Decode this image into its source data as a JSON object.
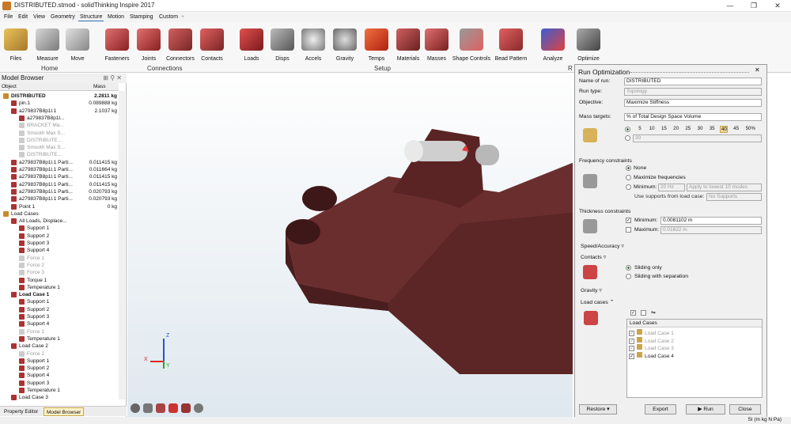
{
  "window": {
    "title": "DISTRIBUTED.stmod - solidThinking Inspire 2017",
    "minimize": "—",
    "restore": "❐",
    "close": "✕"
  },
  "menu": [
    "File",
    "Edit",
    "View",
    "Geometry",
    "Structure",
    "Motion",
    "Stamping",
    "Custom",
    "+"
  ],
  "ribbon": {
    "tools": [
      "Files",
      "Measure",
      "Move",
      "Fasteners",
      "Joints",
      "Connectors",
      "Contacts",
      "Loads",
      "Disps",
      "Accels",
      "Gravity",
      "Temps",
      "Materials",
      "Masses",
      "Shape Controls",
      "Bead Pattern",
      "Analyze",
      "Optimize"
    ],
    "groups": [
      "Home",
      "Connections",
      "Setup",
      "R"
    ]
  },
  "model_browser": {
    "title": "Model Browser",
    "controls": "⊞ ⚲ ✕",
    "col_object": "Object",
    "col_mass": "Mass",
    "rows": [
      {
        "name": "DISTRIBUTED",
        "mass": "2.2811 kg",
        "bold": true,
        "ind": 0
      },
      {
        "name": "pin.1",
        "mass": "0.089888 kg",
        "ind": 1
      },
      {
        "name": "a279837B8p1l.1",
        "mass": "2.1037 kg",
        "ind": 1
      },
      {
        "name": "a279837B8p1l...",
        "mass": "",
        "ind": 2
      },
      {
        "name": "BRACKET Ma...",
        "mass": "",
        "ind": 2,
        "dim": true
      },
      {
        "name": "Smooth Max S...",
        "mass": "",
        "ind": 2,
        "dim": true
      },
      {
        "name": "DISTRIBUTE...",
        "mass": "",
        "ind": 2,
        "dim": true
      },
      {
        "name": "Smooth Max S...",
        "mass": "",
        "ind": 2,
        "dim": true
      },
      {
        "name": "DISTRIBUTE...",
        "mass": "",
        "ind": 2,
        "dim": true
      },
      {
        "name": "a279837B8p1l.1 Parti...",
        "mass": "0.011415 kg",
        "ind": 1
      },
      {
        "name": "a279837B8p1l.1 Parti...",
        "mass": "0.011664 kg",
        "ind": 1
      },
      {
        "name": "a279837B8p1l.1 Parti...",
        "mass": "0.011415 kg",
        "ind": 1
      },
      {
        "name": "a279837B8p1l.1 Parti...",
        "mass": "0.011415 kg",
        "ind": 1
      },
      {
        "name": "a279837B8p1l.1 Parti...",
        "mass": "0.020793 kg",
        "ind": 1
      },
      {
        "name": "a279837B8p1l.1 Parti...",
        "mass": "0.020793 kg",
        "ind": 1
      },
      {
        "name": "Point 1",
        "mass": "0 kg",
        "ind": 1
      },
      {
        "name": "Load Cases",
        "mass": "",
        "ind": 0
      },
      {
        "name": "All Loads, Displace...",
        "mass": "",
        "ind": 1
      },
      {
        "name": "Support 1",
        "mass": "",
        "ind": 2
      },
      {
        "name": "Support 2",
        "mass": "",
        "ind": 2
      },
      {
        "name": "Support 3",
        "mass": "",
        "ind": 2
      },
      {
        "name": "Support 4",
        "mass": "",
        "ind": 2
      },
      {
        "name": "Force 1",
        "mass": "",
        "ind": 2,
        "dim": true
      },
      {
        "name": "Force 2",
        "mass": "",
        "ind": 2,
        "dim": true
      },
      {
        "name": "Force 3",
        "mass": "",
        "ind": 2,
        "dim": true
      },
      {
        "name": "Torque 1",
        "mass": "",
        "ind": 2
      },
      {
        "name": "Temperature 1",
        "mass": "",
        "ind": 2
      },
      {
        "name": "Load Case 1",
        "mass": "",
        "ind": 1,
        "bold": true
      },
      {
        "name": "Support 1",
        "mass": "",
        "ind": 2
      },
      {
        "name": "Support 2",
        "mass": "",
        "ind": 2
      },
      {
        "name": "Support 3",
        "mass": "",
        "ind": 2
      },
      {
        "name": "Support 4",
        "mass": "",
        "ind": 2
      },
      {
        "name": "Force 1",
        "mass": "",
        "ind": 2,
        "dim": true
      },
      {
        "name": "Temperature 1",
        "mass": "",
        "ind": 2
      },
      {
        "name": "Load Case 2",
        "mass": "",
        "ind": 1
      },
      {
        "name": "Force 2",
        "mass": "",
        "ind": 2,
        "dim": true
      },
      {
        "name": "Support 1",
        "mass": "",
        "ind": 2
      },
      {
        "name": "Support 2",
        "mass": "",
        "ind": 2
      },
      {
        "name": "Support 4",
        "mass": "",
        "ind": 2
      },
      {
        "name": "Support 3",
        "mass": "",
        "ind": 2
      },
      {
        "name": "Temperature 1",
        "mass": "",
        "ind": 2
      },
      {
        "name": "Load Case 3",
        "mass": "",
        "ind": 1
      }
    ],
    "tabs": [
      "Property Editor",
      "Model Browser"
    ]
  },
  "viewport": {
    "axis_z": "Z",
    "axis_y": "Y",
    "axis_x": "X"
  },
  "run_opt": {
    "title": "Run Optimization",
    "name_label": "Name of run:",
    "name_value": "DISTRIBUTED",
    "runtype_label": "Run type:",
    "runtype_value": "Topology",
    "objective_label": "Objective:",
    "objective_value": "Maximize Stiffness",
    "mass_label": "Mass targets:",
    "mass_value": "% of Total Design Space Volume",
    "mass_pcts": [
      "5",
      "10",
      "15",
      "20",
      "25",
      "30",
      "35",
      "40",
      "45",
      "50%"
    ],
    "mass_custom": "30",
    "freq_title": "Frequency constraints",
    "freq_none": "None",
    "freq_max": "Maximize frequencies",
    "freq_min": "Minimum:",
    "freq_min_val": "20 Hz",
    "freq_apply": "Apply to lowest 10 modes",
    "freq_supports": "Use supports from load case:",
    "freq_supports_val": "No Supports",
    "thick_title": "Thickness constraints",
    "thick_min": "Minimum:",
    "thick_min_val": "0.0081102 m",
    "thick_max": "Maximum:",
    "thick_max_val": "0.01622 m",
    "speed": "Speed/Accuracy",
    "contacts": "Contacts",
    "contacts_sliding": "Sliding only",
    "contacts_sep": "Sliding with separation",
    "gravity": "Gravity",
    "loadcases": "Load cases",
    "lc_header": "Load Cases",
    "lc_items": [
      "Load Case 1",
      "Load Case 2",
      "Load Case 3",
      "Load Case 4"
    ],
    "restore": "Restore",
    "export": "Export",
    "run": "▶ Run",
    "close": "Close"
  },
  "status": {
    "units": "SI (m kg N Pa)"
  },
  "colors": {
    "accent": "#2d6fb6",
    "part": "#6b2e2e",
    "pin": "#c9c9c9"
  }
}
